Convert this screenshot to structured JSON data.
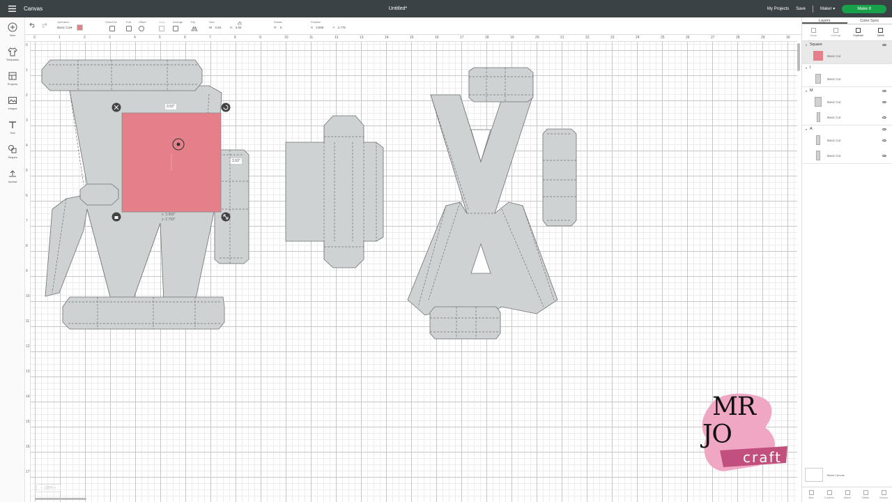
{
  "topbar": {
    "app_title": "Canvas",
    "doc_title": "Untitled*",
    "my_projects": "My Projects",
    "save": "Save",
    "machine": "Maker",
    "make_it": "Make It"
  },
  "left_tools": [
    {
      "label": "New",
      "icon": "plus-icon"
    },
    {
      "label": "Templates",
      "icon": "shirt-icon"
    },
    {
      "label": "Projects",
      "icon": "projects-icon"
    },
    {
      "label": "Images",
      "icon": "image-icon"
    },
    {
      "label": "Text",
      "icon": "text-icon"
    },
    {
      "label": "Shapes",
      "icon": "shapes-icon"
    },
    {
      "label": "Upload",
      "icon": "upload-icon"
    }
  ],
  "editbar": {
    "operation_label": "Operation",
    "operation_value": "Basic Cut",
    "operation_color": "#e5808a",
    "select_all_label": "Select All",
    "edit_label": "Edit",
    "offset_label": "Offset",
    "align_label": "Align",
    "arrange_label": "Arrange",
    "flip_label": "Flip",
    "size_label": "Size",
    "size_w_prefix": "W",
    "size_w": "3.93",
    "size_h_prefix": "H",
    "size_h": "3.93",
    "rotate_label": "Rotate",
    "rotate_value": "0",
    "position_label": "Position",
    "position_x_prefix": "X",
    "position_x": "3.569",
    "position_y_prefix": "Y",
    "position_y": "2.776"
  },
  "ruler": {
    "top_numbers": [
      "0",
      "1",
      "2",
      "3",
      "4",
      "5",
      "6",
      "7",
      "8",
      "9",
      "10",
      "11",
      "12",
      "13",
      "14",
      "15",
      "16",
      "17",
      "18",
      "19",
      "20",
      "21",
      "22",
      "23",
      "24",
      "25",
      "26",
      "27",
      "28",
      "29",
      "30"
    ],
    "left_numbers": [
      "0",
      "1",
      "2",
      "3",
      "4",
      "5",
      "6",
      "7",
      "8",
      "9",
      "10",
      "11",
      "12",
      "13",
      "14",
      "15",
      "16",
      "17"
    ]
  },
  "selection": {
    "width_label": "3.93\"",
    "height_label": "3.93\"",
    "x_readout": "x: 3.569\"",
    "y_readout": "y: 2.793\"",
    "fill": "#e5808a"
  },
  "right_panel": {
    "tab_layers": "Layers",
    "tab_color_sync": "Color Sync",
    "actions": [
      "Group",
      "UnGroup",
      "Duplicate",
      "Delete"
    ],
    "groups": [
      {
        "name": "Square",
        "layers": [
          {
            "label": "Basic Cut"
          }
        ]
      },
      {
        "name": "I",
        "layers": [
          {
            "label": "Basic Cut"
          }
        ]
      },
      {
        "name": "M",
        "layers": [
          {
            "label": "Basic Cut"
          },
          {
            "label": "Basic Cut"
          }
        ]
      },
      {
        "name": "A",
        "layers": [
          {
            "label": "Basic Cut"
          },
          {
            "label": "Basic Cut"
          }
        ]
      }
    ],
    "blank_canvas": "Blank Canvas",
    "bottom_actions": [
      "Slice",
      "Combine",
      "Attach",
      "Flatten",
      "Contour"
    ]
  },
  "watermark": {
    "line1": "MR",
    "line2": "JO",
    "line3": "craft"
  },
  "zoom": "100%"
}
